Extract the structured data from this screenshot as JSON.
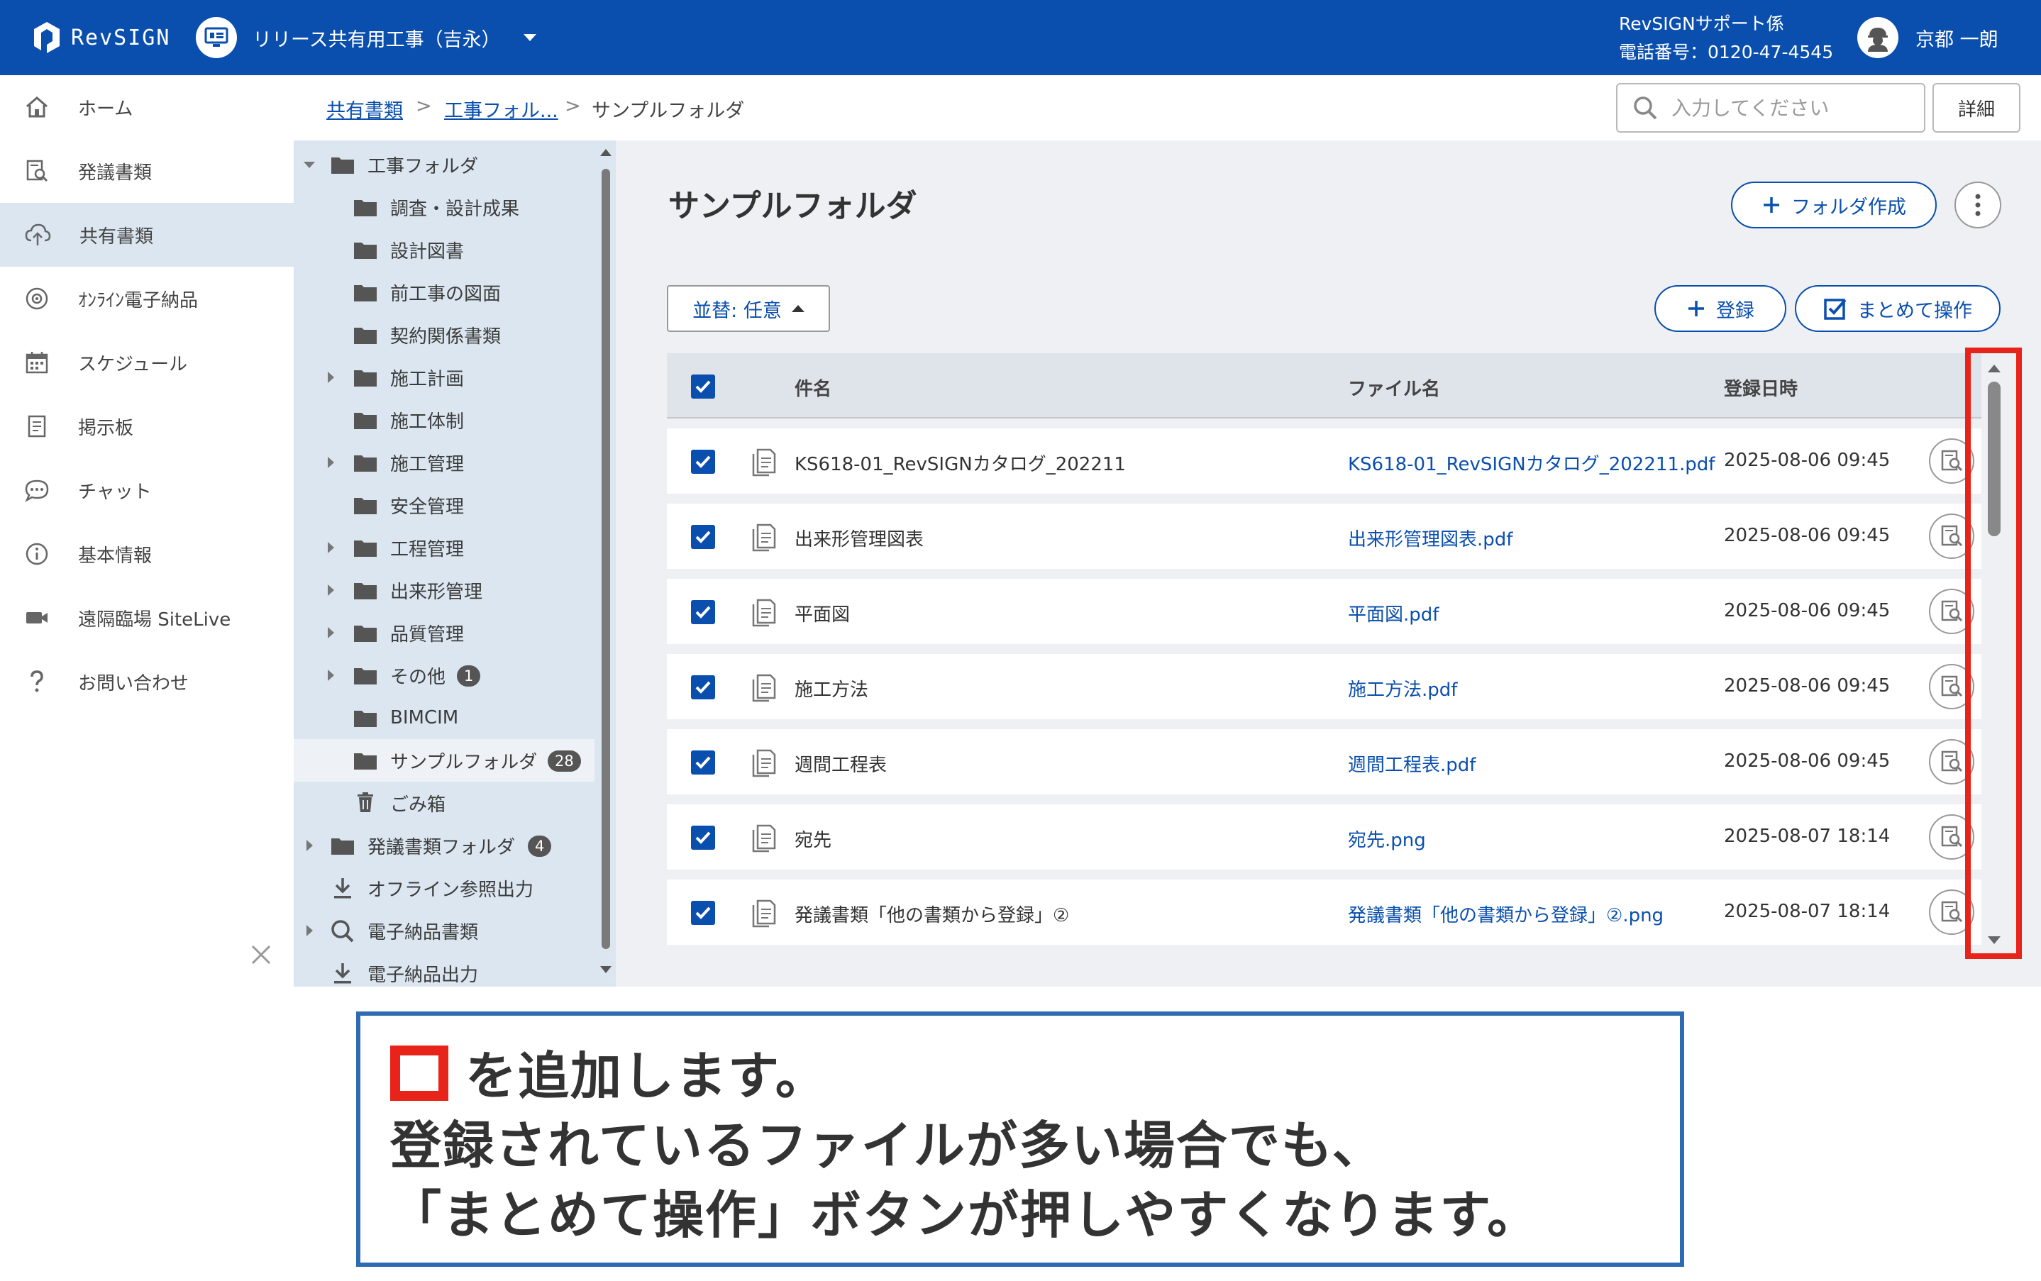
{
  "header": {
    "logo_text": "RevSIGN",
    "project_name": "リリース共有用工事（吉永）",
    "support_name": "RevSIGNサポート係",
    "support_phone": "電話番号：0120-47-4545",
    "user_name": "京都 一朗"
  },
  "sidebar": {
    "items": [
      {
        "label": "ホーム",
        "icon": "home-icon"
      },
      {
        "label": "発議書類",
        "icon": "document-search-icon"
      },
      {
        "label": "共有書類",
        "icon": "cloud-upload-icon",
        "active": true
      },
      {
        "label": "ｵﾝﾗｲﾝ電子納品",
        "icon": "disc-icon"
      },
      {
        "label": "スケジュール",
        "icon": "calendar-icon"
      },
      {
        "label": "掲示板",
        "icon": "board-icon"
      },
      {
        "label": "チャット",
        "icon": "chat-icon"
      },
      {
        "label": "基本情報",
        "icon": "info-icon"
      },
      {
        "label": "遠隔臨場 SiteLive",
        "icon": "video-icon"
      },
      {
        "label": "お問い合わせ",
        "icon": "question-icon"
      }
    ]
  },
  "breadcrumb": {
    "items": [
      "共有書類",
      "工事フォル...",
      "サンプルフォルダ"
    ],
    "separator": ">"
  },
  "search": {
    "placeholder": "入力してください",
    "detail_label": "詳細"
  },
  "tree": {
    "items": [
      {
        "label": "工事フォルダ",
        "level": 0,
        "expander": "down",
        "icon": "folder-icon"
      },
      {
        "label": "調査・設計成果",
        "level": 1,
        "icon": "folder-icon"
      },
      {
        "label": "設計図書",
        "level": 1,
        "icon": "folder-icon"
      },
      {
        "label": "前工事の図面",
        "level": 1,
        "icon": "folder-icon"
      },
      {
        "label": "契約関係書類",
        "level": 1,
        "icon": "folder-icon"
      },
      {
        "label": "施工計画",
        "level": 1,
        "expander": "right",
        "icon": "folder-icon"
      },
      {
        "label": "施工体制",
        "level": 1,
        "icon": "folder-icon"
      },
      {
        "label": "施工管理",
        "level": 1,
        "expander": "right",
        "icon": "folder-icon"
      },
      {
        "label": "安全管理",
        "level": 1,
        "icon": "folder-icon"
      },
      {
        "label": "工程管理",
        "level": 1,
        "expander": "right",
        "icon": "folder-icon"
      },
      {
        "label": "出来形管理",
        "level": 1,
        "expander": "right",
        "icon": "folder-icon"
      },
      {
        "label": "品質管理",
        "level": 1,
        "expander": "right",
        "icon": "folder-icon"
      },
      {
        "label": "その他",
        "level": 1,
        "expander": "right",
        "icon": "folder-icon",
        "badge": "1"
      },
      {
        "label": "BIMCIM",
        "level": 1,
        "icon": "folder-icon"
      },
      {
        "label": "サンプルフォルダ",
        "level": 1,
        "icon": "folder-icon",
        "badge": "28",
        "selected": true
      },
      {
        "label": "ごみ箱",
        "level": 1,
        "icon": "trash-icon"
      },
      {
        "label": "発議書類フォルダ",
        "level": 0,
        "expander": "right",
        "icon": "folder-icon",
        "badge": "4"
      },
      {
        "label": "オフライン参照出力",
        "level": 0,
        "icon": "download-icon"
      },
      {
        "label": "電子納品書類",
        "level": 0,
        "expander": "right",
        "icon": "search-icon"
      },
      {
        "label": "電子納品出力",
        "level": 0,
        "icon": "download-icon"
      }
    ]
  },
  "main": {
    "title": "サンプルフォルダ",
    "create_folder_label": "フォルダ作成",
    "sort_label": "並替: 任意",
    "register_label": "登録",
    "bulk_label": "まとめて操作",
    "columns": [
      "件名",
      "ファイル名",
      "登録日時"
    ],
    "rows": [
      {
        "name": "KS618-01_RevSIGNカタログ_202211",
        "file": "KS618-01_RevSIGNカタログ_202211.pdf",
        "date": "2025-08-06 09:45"
      },
      {
        "name": "出来形管理図表",
        "file": "出来形管理図表.pdf",
        "date": "2025-08-06 09:45"
      },
      {
        "name": "平面図",
        "file": "平面図.pdf",
        "date": "2025-08-06 09:45"
      },
      {
        "name": "施工方法",
        "file": "施工方法.pdf",
        "date": "2025-08-06 09:45"
      },
      {
        "name": "週間工程表",
        "file": "週間工程表.pdf",
        "date": "2025-08-06 09:45"
      },
      {
        "name": "宛先",
        "file": "宛先.png",
        "date": "2025-08-07 18:14"
      },
      {
        "name": "発議書類「他の書類から登録」②",
        "file": "発議書類「他の書類から登録」②.png",
        "date": "2025-08-07 18:14"
      }
    ]
  },
  "callout": {
    "line1": "を追加します。",
    "line2": "登録されているファイルが多い場合でも、",
    "line3": "「まとめて操作」ボタンが押しやすくなります。"
  },
  "colors": {
    "brand": "#0a4fae",
    "highlight": "#e8231a",
    "callout_border": "#2d6bb3"
  }
}
